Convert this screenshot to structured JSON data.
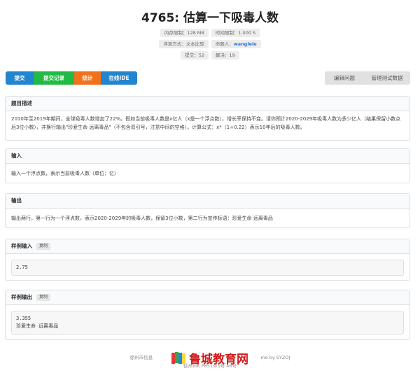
{
  "problem": {
    "title": "4765: 估算一下吸毒人数",
    "limits": {
      "memory": "内存限制：128 MB",
      "time": "时间限制：1.000 S"
    },
    "meta": {
      "judge": "评测方式：文本比较",
      "author_label": "命题人：",
      "author": "wanglele"
    },
    "stats": {
      "submit": "提交：52",
      "solved": "解决：19"
    }
  },
  "toolbar": {
    "submit": "提交",
    "records": "提交记录",
    "statistics": "统计",
    "ide": "在线IDE",
    "edit": "编辑问题",
    "manage_data": "管理测试数据"
  },
  "sections": {
    "description": {
      "title": "题目描述",
      "body": "2010年至2019年期间，全球吸毒人数增加了22%。假如当前吸毒人数是x亿人（x是一个浮点数），增长率保持不变。请你预计2020-2029年吸毒人数为多少亿人（结果保留小数点后3位小数），并换行输出\"珍爱生命 远离毒品\"（不包含双引号，注意中间的空格）。计算公式：x*（1+0.22）表示10年后的吸毒人数。"
    },
    "input": {
      "title": "输入",
      "body": "输入一个浮点数，表示当前吸毒人数（单位：亿）"
    },
    "output": {
      "title": "输出",
      "body": "输出两行，第一行为一个浮点数，表示2020-2029年的吸毒人数，保留3位小数，第二行为宣传标语：珍爱生命 远离毒品"
    },
    "sample_input": {
      "title": "样例输入",
      "copy": "复制",
      "code": "2.75"
    },
    "sample_output": {
      "title": "样例输出",
      "copy": "复制",
      "code": "3.355\n珍爱生命 远离毒品"
    }
  },
  "footer": {
    "left": "徐州市信息",
    "right": "me by SYZOJ",
    "line2": "徐州市K P8519/3号 46号"
  },
  "watermark": {
    "text": "鲁城教育网",
    "logo_colors": [
      "#e53935",
      "#43a047",
      "#1e88e5",
      "#fdd835"
    ]
  }
}
